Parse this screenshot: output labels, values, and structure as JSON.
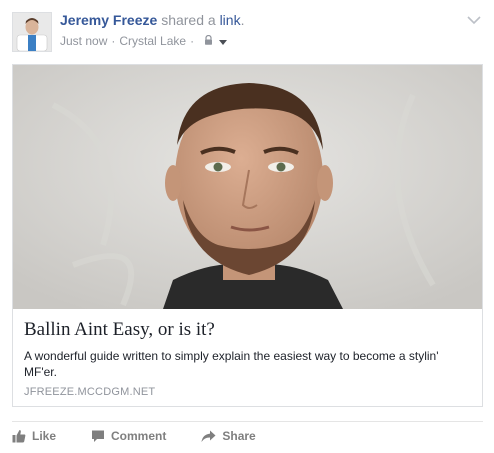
{
  "post": {
    "author": "Jeremy Freeze",
    "action": "shared a",
    "action_link": "link",
    "punctuation": ".",
    "timestamp": "Just now",
    "separator": "·",
    "location": "Crystal Lake",
    "privacy_icon": "lock-icon",
    "audience_icon": "caret-down-icon",
    "menu_icon": "chevron-down-icon"
  },
  "link_card": {
    "title": "Ballin Aint Easy, or is it?",
    "description": "A wonderful guide written to simply explain the easiest way to become a stylin' MF'er.",
    "domain": "JFREEZE.MCCDGM.NET",
    "image": "portrait of a man"
  },
  "actions": {
    "like": {
      "label": "Like",
      "icon": "thumbs-up-icon"
    },
    "comment": {
      "label": "Comment",
      "icon": "comment-icon"
    },
    "share": {
      "label": "Share",
      "icon": "share-icon"
    }
  },
  "colors": {
    "link": "#365899",
    "secondary": "#90949c",
    "text": "#1d2129"
  }
}
